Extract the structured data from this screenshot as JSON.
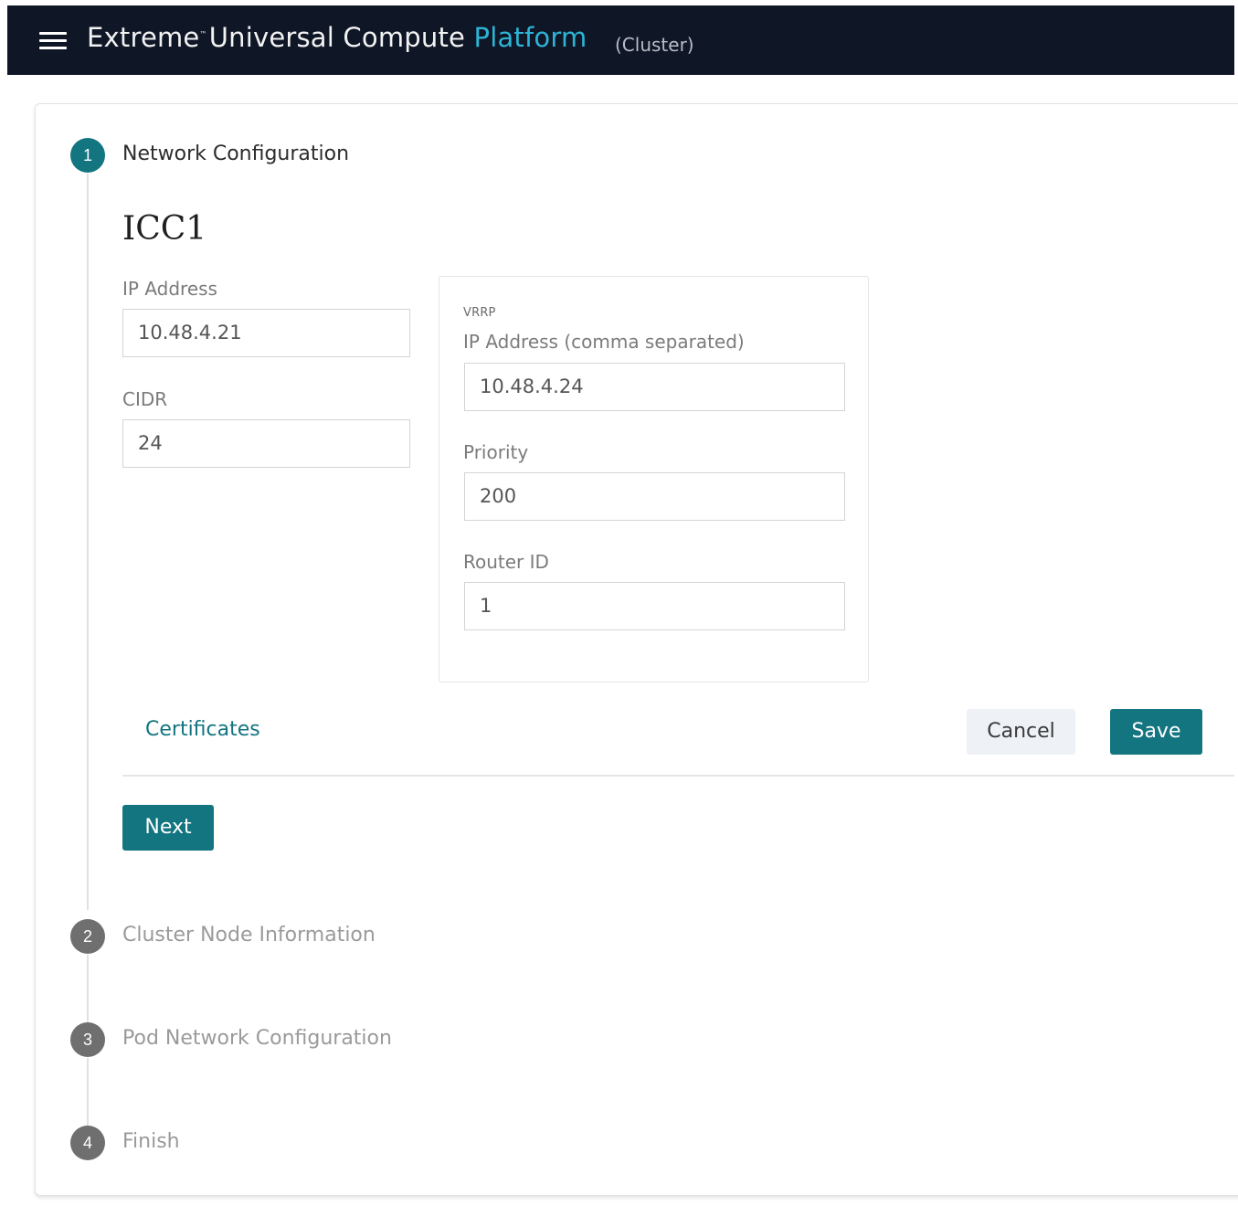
{
  "header": {
    "brand_part1": "Extreme",
    "brand_tm": "™",
    "brand_part2": "Universal Compute",
    "brand_accent": "Platform",
    "scope": "(Cluster)"
  },
  "steps": [
    {
      "number": "1",
      "label": "Network Configuration",
      "state": "active"
    },
    {
      "number": "2",
      "label": "Cluster Node Information",
      "state": "inactive"
    },
    {
      "number": "3",
      "label": "Pod Network Configuration",
      "state": "inactive"
    },
    {
      "number": "4",
      "label": "Finish",
      "state": "inactive"
    }
  ],
  "form": {
    "section_title": "ICC1",
    "ip_address": {
      "label": "IP Address",
      "value": "10.48.4.21"
    },
    "cidr": {
      "label": "CIDR",
      "value": "24"
    },
    "vrrp": {
      "caption": "VRRP",
      "ip_address": {
        "label": "IP Address (comma separated)",
        "value": "10.48.4.24"
      },
      "priority": {
        "label": "Priority",
        "value": "200"
      },
      "router_id": {
        "label": "Router ID",
        "value": "1"
      }
    }
  },
  "actions": {
    "certificates_link": "Certificates",
    "cancel_label": "Cancel",
    "save_label": "Save",
    "next_label": "Next"
  },
  "colors": {
    "topbar": "#0f1626",
    "brand_accent": "#2db4d6",
    "primary": "#137580",
    "inactive_step": "#6f6f6f"
  }
}
